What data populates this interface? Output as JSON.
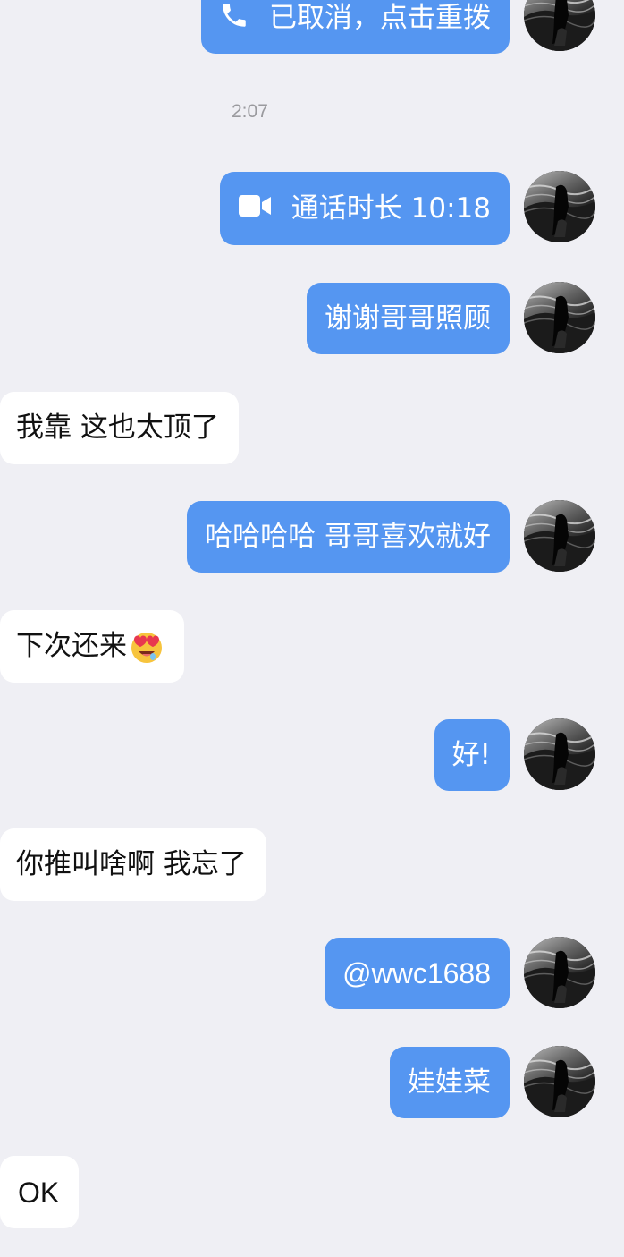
{
  "conversation": {
    "timestamp": "2:07",
    "messages": [
      {
        "id": "m1",
        "side": "out",
        "kind": "call-cancelled",
        "icon": "phone-icon",
        "text": "已取消，点击重拨"
      },
      {
        "id": "m2",
        "side": "out",
        "kind": "video-call",
        "icon": "video-camera-icon",
        "text": "通话时长 10:18"
      },
      {
        "id": "m3",
        "side": "out",
        "kind": "text",
        "text": "谢谢哥哥照顾"
      },
      {
        "id": "m4",
        "side": "in",
        "kind": "text",
        "text": "我靠 这也太顶了"
      },
      {
        "id": "m5",
        "side": "out",
        "kind": "text",
        "text": "哈哈哈哈 哥哥喜欢就好"
      },
      {
        "id": "m6",
        "side": "in",
        "kind": "text",
        "text": "下次还来",
        "emoji": "heart-eyes-emoji"
      },
      {
        "id": "m7",
        "side": "out",
        "kind": "text",
        "text": "好!"
      },
      {
        "id": "m8",
        "side": "in",
        "kind": "text",
        "text": "你推叫啥啊 我忘了"
      },
      {
        "id": "m9",
        "side": "out",
        "kind": "text",
        "text": "@wwc1688"
      },
      {
        "id": "m10",
        "side": "out",
        "kind": "text",
        "text": "娃娃菜"
      },
      {
        "id": "m11",
        "side": "in",
        "kind": "text",
        "text": "OK"
      }
    ]
  },
  "colors": {
    "background": "#efeff4",
    "outgoing_bubble": "#5596f1",
    "incoming_bubble": "#ffffff",
    "timestamp": "#9a9a9e"
  }
}
